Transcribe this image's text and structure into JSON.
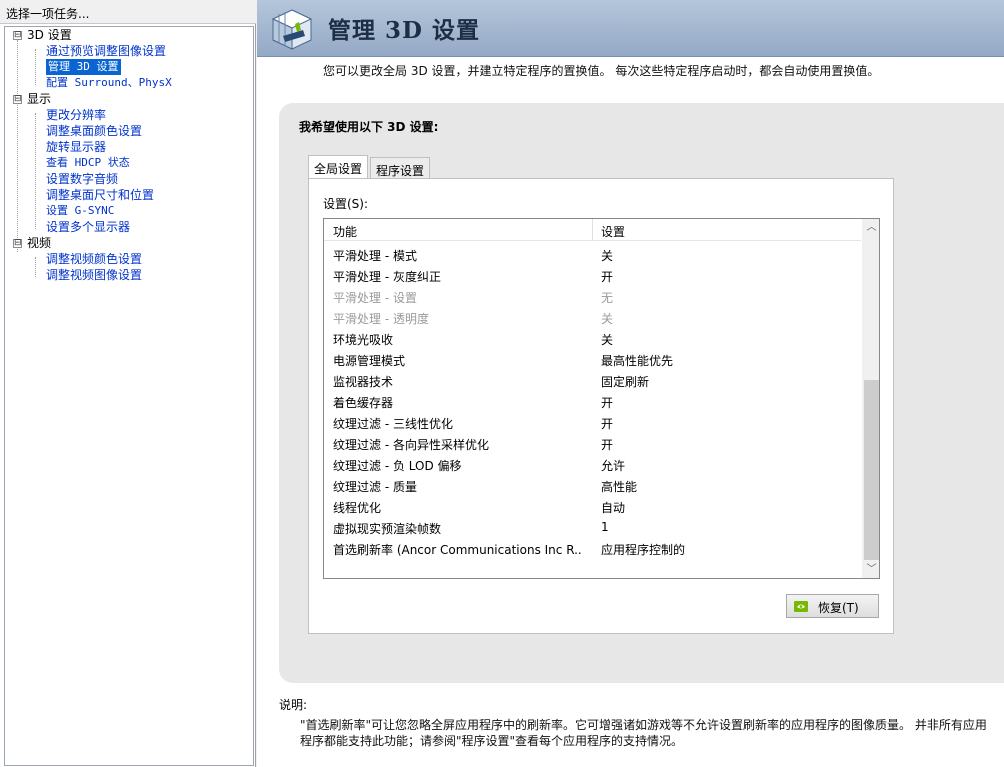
{
  "left": {
    "header": "选择一项任务...",
    "tree": [
      {
        "label": "3D 设置",
        "expander": "⊟",
        "children": [
          "通过预览调整图像设置",
          "管理 3D 设置",
          "配置 Surround、PhysX"
        ]
      },
      {
        "label": "显示",
        "expander": "⊟",
        "children": [
          "更改分辨率",
          "调整桌面颜色设置",
          "旋转显示器",
          "查看 HDCP 状态",
          "设置数字音频",
          "调整桌面尺寸和位置",
          "设置 G-SYNC",
          "设置多个显示器"
        ]
      },
      {
        "label": "视频",
        "expander": "⊟",
        "children": [
          "调整视频颜色设置",
          "调整视频图像设置"
        ]
      }
    ]
  },
  "banner": {
    "title": "管理 3D 设置"
  },
  "intro": "您可以更改全局 3D 设置，并建立特定程序的置换值。 每次这些特定程序启动时，都会自动使用置换值。",
  "panel": {
    "heading": "我希望使用以下 3D 设置:",
    "tabs": [
      "全局设置",
      "程序设置"
    ],
    "settings_label": "设置(S):",
    "columns": [
      "功能",
      "设置"
    ],
    "rows": [
      {
        "feature": "平滑处理 - 模式",
        "value": "关",
        "disabled": false
      },
      {
        "feature": "平滑处理 - 灰度纠正",
        "value": "开",
        "disabled": false
      },
      {
        "feature": "平滑处理 - 设置",
        "value": "无",
        "disabled": true
      },
      {
        "feature": "平滑处理 - 透明度",
        "value": "关",
        "disabled": true
      },
      {
        "feature": "环境光吸收",
        "value": "关",
        "disabled": false
      },
      {
        "feature": "电源管理模式",
        "value": "最高性能优先",
        "disabled": false
      },
      {
        "feature": "监视器技术",
        "value": "固定刷新",
        "disabled": false
      },
      {
        "feature": "着色缓存器",
        "value": "开",
        "disabled": false
      },
      {
        "feature": "纹理过滤 - 三线性优化",
        "value": "开",
        "disabled": false
      },
      {
        "feature": "纹理过滤 - 各向异性采样优化",
        "value": "开",
        "disabled": false
      },
      {
        "feature": "纹理过滤 - 负 LOD 偏移",
        "value": "允许",
        "disabled": false
      },
      {
        "feature": "纹理过滤 - 质量",
        "value": "高性能",
        "disabled": false
      },
      {
        "feature": "线程优化",
        "value": "自动",
        "disabled": false
      },
      {
        "feature": "虚拟现实预渲染帧数",
        "value": "1",
        "disabled": false
      },
      {
        "feature": "首选刷新率 (Ancor Communications Inc R...",
        "value": "应用程序控制的",
        "disabled": false
      }
    ],
    "restore_label": "恢复(T)"
  },
  "description": {
    "title": "说明:",
    "text": "\"首选刷新率\"可让您忽略全屏应用程序中的刷新率。它可增强诸如游戏等不允许设置刷新率的应用程序的图像质量。 并非所有应用程序都能支持此功能；请参阅\"程序设置\"查看每个应用程序的支持情况。"
  },
  "colors": {
    "selected": "#0a64d2",
    "link": "#0033cc",
    "banner": "#a4b7d0",
    "nvidia_green": "#76b900"
  }
}
